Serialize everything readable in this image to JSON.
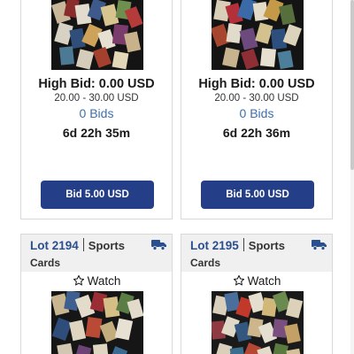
{
  "top_cards": [
    {
      "high_bid": "High Bid: 0.00 USD",
      "estimate_range": "20.00 - 30.00 USD",
      "bids": "0 Bids",
      "time_left": "6d 22h 35m",
      "bid_button_label": "Bid 5.00 USD"
    },
    {
      "high_bid": "High Bid: 0.00 USD",
      "estimate_range": "20.00 - 30.00 USD",
      "bids": "0 Bids",
      "time_left": "6d 22h 36m",
      "bid_button_label": "Bid 5.00 USD"
    }
  ],
  "bottom_cards": [
    {
      "lot_label": "Lot 2194",
      "category_first": "Sports",
      "category_second": "Cards",
      "watch_label": "Watch",
      "shipping_icon": "truck-icon",
      "watch_icon": "star-outline-icon"
    },
    {
      "lot_label": "Lot 2195",
      "category_first": "Sports",
      "category_second": "Cards",
      "watch_label": "Watch",
      "shipping_icon": "truck-icon",
      "watch_icon": "star-outline-icon"
    }
  ],
  "colors": {
    "button_bg": "#243e88",
    "lot_number": "#2a4f8e",
    "bids_link": "#3d6fb0",
    "truck": "#2a4f8e",
    "header_bg": "#f0f0f0"
  }
}
